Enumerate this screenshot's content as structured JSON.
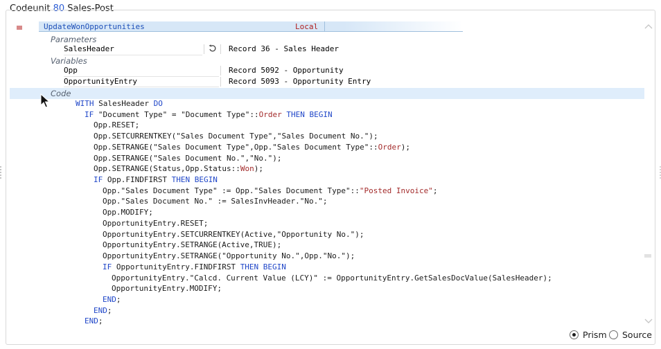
{
  "header": {
    "title_prefix": "Codeunit",
    "title_number": "80",
    "title_name": "Sales-Post"
  },
  "procedure": {
    "name": "UpdateWonOpportunities",
    "scope": "Local"
  },
  "parameters": {
    "label": "Parameters",
    "items": [
      {
        "name": "SalesHeader",
        "type": "Record 36 - Sales Header"
      }
    ]
  },
  "variables": {
    "label": "Variables",
    "items": [
      {
        "name": "Opp",
        "type": "Record 5092 - Opportunity"
      },
      {
        "name": "OpportunityEntry",
        "type": "Record 5093 - Opportunity Entry"
      }
    ]
  },
  "code": {
    "label": "Code",
    "lines": [
      [
        [
          "kw",
          "WITH"
        ],
        [
          "t",
          " SalesHeader "
        ],
        [
          "kw",
          "DO"
        ]
      ],
      [
        [
          "kw",
          "IF"
        ],
        [
          "t",
          " \"Document Type\" = \"Document Type\"::"
        ],
        [
          "str",
          "Order"
        ],
        [
          "t",
          " "
        ],
        [
          "kw",
          "THEN BEGIN"
        ]
      ],
      [
        [
          "t",
          "Opp.RESET;"
        ]
      ],
      [
        [
          "t",
          "Opp.SETCURRENTKEY(\"Sales Document Type\",\"Sales Document No.\");"
        ]
      ],
      [
        [
          "t",
          "Opp.SETRANGE(\"Sales Document Type\",Opp.\"Sales Document Type\"::"
        ],
        [
          "str",
          "Order"
        ],
        [
          "t",
          ");"
        ]
      ],
      [
        [
          "t",
          "Opp.SETRANGE(\"Sales Document No.\",\"No.\");"
        ]
      ],
      [
        [
          "t",
          "Opp.SETRANGE(Status,Opp.Status::"
        ],
        [
          "str",
          "Won"
        ],
        [
          "t",
          ");"
        ]
      ],
      [
        [
          "kw",
          "IF"
        ],
        [
          "t",
          " Opp.FINDFIRST "
        ],
        [
          "kw",
          "THEN BEGIN"
        ]
      ],
      [
        [
          "t",
          "Opp.\"Sales Document Type\" := Opp.\"Sales Document Type\"::"
        ],
        [
          "str",
          "\"Posted Invoice\""
        ],
        [
          "t",
          ";"
        ]
      ],
      [
        [
          "t",
          "Opp.\"Sales Document No.\" := SalesInvHeader.\"No.\";"
        ]
      ],
      [
        [
          "t",
          "Opp.MODIFY;"
        ]
      ],
      [
        [
          "t",
          "OpportunityEntry.RESET;"
        ]
      ],
      [
        [
          "t",
          "OpportunityEntry.SETCURRENTKEY(Active,\"Opportunity No.\");"
        ]
      ],
      [
        [
          "t",
          "OpportunityEntry.SETRANGE(Active,TRUE);"
        ]
      ],
      [
        [
          "t",
          "OpportunityEntry.SETRANGE(\"Opportunity No.\",Opp.\"No.\");"
        ]
      ],
      [
        [
          "kw",
          "IF"
        ],
        [
          "t",
          " OpportunityEntry.FINDFIRST "
        ],
        [
          "kw",
          "THEN BEGIN"
        ]
      ],
      [
        [
          "t",
          "OpportunityEntry.\"Calcd. Current Value (LCY)\" := OpportunityEntry.GetSalesDocValue(SalesHeader);"
        ]
      ],
      [
        [
          "t",
          "OpportunityEntry.MODIFY;"
        ]
      ],
      [
        [
          "kw",
          "END"
        ],
        [
          "t",
          ";"
        ]
      ],
      [
        [
          "kw",
          "END"
        ],
        [
          "t",
          ";"
        ]
      ],
      [
        [
          "kw",
          "END"
        ],
        [
          "t",
          ";"
        ]
      ]
    ],
    "indents": [
      0,
      1,
      2,
      2,
      2,
      2,
      2,
      2,
      3,
      3,
      3,
      3,
      3,
      3,
      3,
      3,
      4,
      4,
      3,
      2,
      1
    ]
  },
  "view_mode": {
    "options": [
      {
        "label": "Prism",
        "selected": true
      },
      {
        "label": "Source",
        "selected": false
      }
    ]
  },
  "icons": {
    "undo": "undo-arrow-icon",
    "cursor": "mouse-pointer-icon",
    "collapse": "chevron-up-icon",
    "expand": "chevron-down-icon"
  }
}
